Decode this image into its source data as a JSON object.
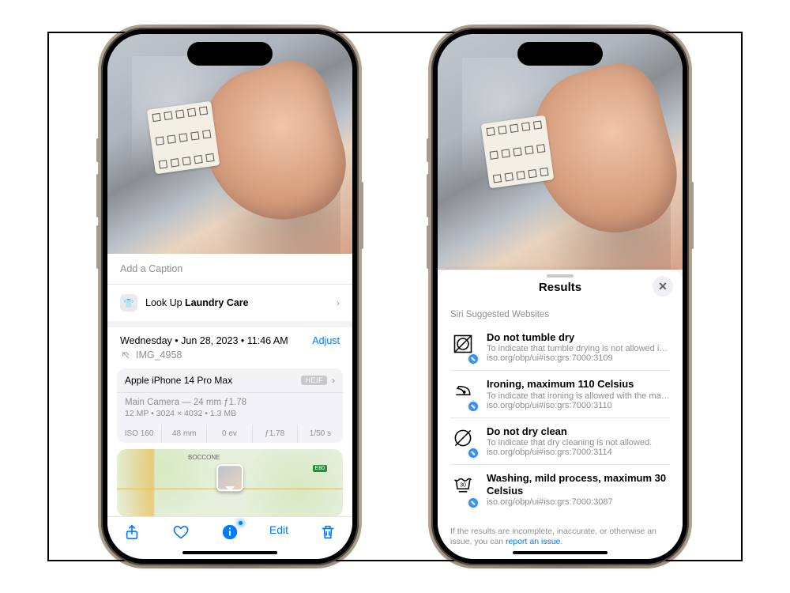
{
  "left": {
    "caption_placeholder": "Add a Caption",
    "lookup": {
      "prefix": "Look Up ",
      "subject": "Laundry Care"
    },
    "datetime": {
      "weekday": "Wednesday",
      "date": "Jun 28, 2023",
      "time": "11:46 AM"
    },
    "adjust_label": "Adjust",
    "filename": "IMG_4958",
    "device": {
      "model": "Apple iPhone 14 Pro Max",
      "format": "HEIF",
      "camera": "Main Camera — 24 mm ƒ1.78",
      "specs_line": "12 MP  •  3024 × 4032  •  1.3 MB",
      "exif": {
        "iso": "ISO 160",
        "focal": "48 mm",
        "ev": "0 ev",
        "aperture": "ƒ1.78",
        "shutter": "1/50 s"
      }
    },
    "map": {
      "locality": "BOCCONE",
      "road": "E80"
    },
    "tabbar": {
      "edit": "Edit"
    }
  },
  "right": {
    "title": "Results",
    "section": "Siri Suggested Websites",
    "results": [
      {
        "title": "Do not tumble dry",
        "desc": "To indicate that tumble drying is not allowed in the…",
        "url": "iso.org/obp/ui#iso:grs:7000:3109"
      },
      {
        "title": "Ironing, maximum 110 Celsius",
        "desc": "To indicate that ironing is allowed with the maximu…",
        "url": "iso.org/obp/ui#iso:grs:7000:3110"
      },
      {
        "title": "Do not dry clean",
        "desc": "To indicate that dry cleaning is not allowed.",
        "url": "iso.org/obp/ui#iso:grs:7000:3114"
      },
      {
        "title": "Washing, mild process, maximum 30 Celsius",
        "desc": "",
        "url": "iso.org/obp/ui#iso:grs:7000:3087"
      }
    ],
    "footnote_prefix": "If the results are incomplete, inaccurate, or otherwise an issue, you can ",
    "footnote_link": "report an issue",
    "footnote_suffix": "."
  }
}
